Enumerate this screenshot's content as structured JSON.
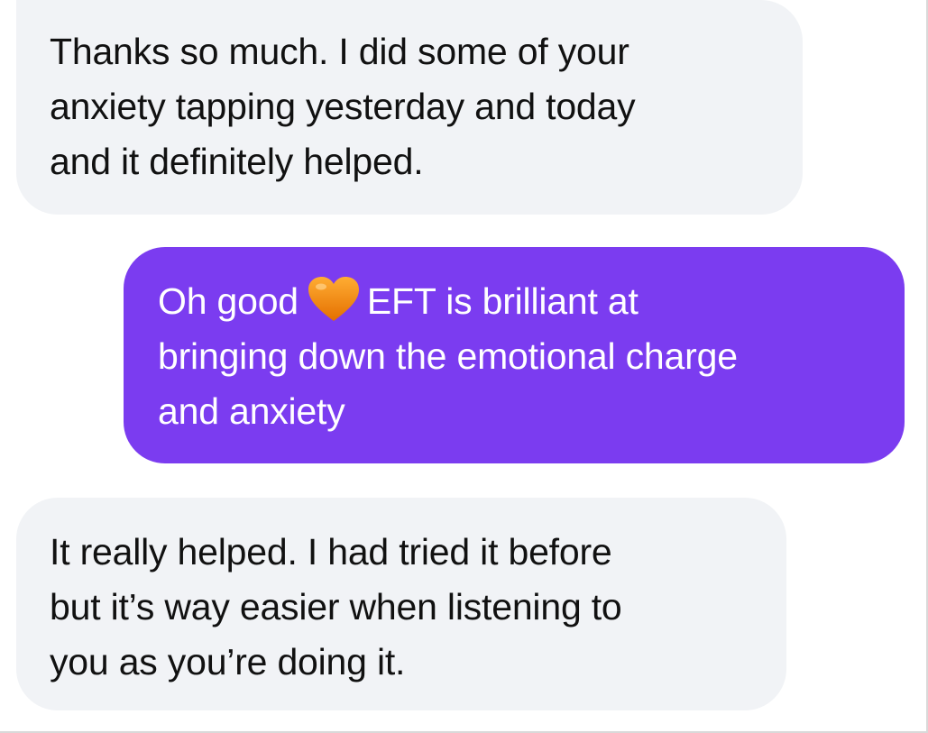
{
  "conversation": {
    "messages": [
      {
        "direction": "incoming",
        "text": "Thanks so much. I did some of your\nanxiety tapping yesterday and today\nand it definitely helped."
      },
      {
        "direction": "outgoing",
        "text_before_emoji": "Oh good",
        "emoji": "orange-heart-icon",
        "text_after_emoji": "EFT is brilliant at\nbringing down the emotional charge\nand anxiety"
      },
      {
        "direction": "incoming",
        "text": "It really helped. I had tried it before\nbut it’s way easier when listening to\nyou as you’re doing it."
      }
    ]
  },
  "colors": {
    "incoming_bubble": "#f1f3f6",
    "outgoing_bubble": "#7b3cf0",
    "emoji_heart": "#f28a16"
  }
}
